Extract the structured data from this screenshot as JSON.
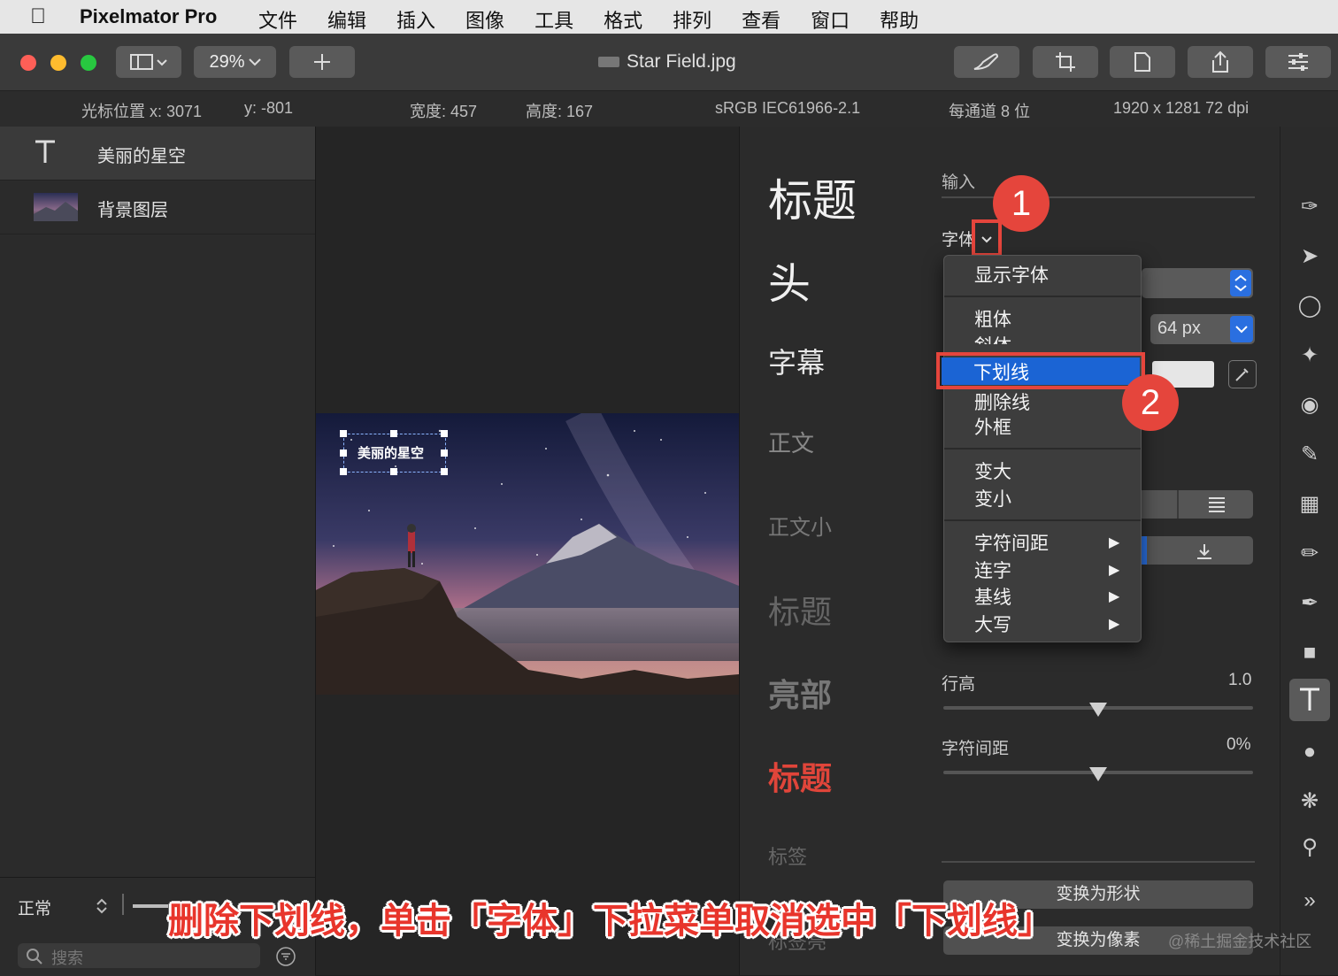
{
  "menubar": {
    "app_name": "Pixelmator Pro",
    "items": [
      "文件",
      "编辑",
      "插入",
      "图像",
      "工具",
      "格式",
      "排列",
      "查看",
      "窗口",
      "帮助"
    ]
  },
  "toolbar": {
    "zoom": "29%",
    "document_title": "Star Field.jpg"
  },
  "infobar": {
    "cursor_x": "光标位置 x:  3071",
    "cursor_y": "y:  -801",
    "width": "宽度:  457",
    "height": "高度:  167",
    "color_profile": "sRGB IEC61966-2.1",
    "bit_depth": "每通道 8 位",
    "dimensions": "1920 x 1281 72 dpi"
  },
  "layers": {
    "items": [
      {
        "label": "美丽的星空",
        "type": "text"
      },
      {
        "label": "背景图层",
        "type": "image"
      }
    ],
    "blend_mode": "正常",
    "search_placeholder": "搜索"
  },
  "canvas": {
    "overlay_text": "美丽的星空"
  },
  "styles": {
    "items": [
      "标题",
      "头",
      "字幕",
      "正文",
      "正文小",
      "标题",
      "亮部",
      "标题",
      "标签",
      "标签亮"
    ]
  },
  "inspector": {
    "input_label": "输入",
    "font_label": "字体",
    "size_value": "64 px",
    "line_height_label": "行高",
    "line_height_value": "1.0",
    "char_spacing_label": "字符间距",
    "char_spacing_value": "0%",
    "convert_shape": "变换为形状",
    "convert_pixels": "变换为像素"
  },
  "font_menu": {
    "show_fonts": "显示字体",
    "bold": "粗体",
    "italic": "斜体",
    "underline": "下划线",
    "strikethrough": "删除线",
    "outline": "外框",
    "bigger": "变大",
    "smaller": "变小",
    "kerning": "字符间距",
    "ligature": "连字",
    "baseline": "基线",
    "capitalization": "大写"
  },
  "callouts": {
    "one": "1",
    "two": "2"
  },
  "caption": "删除下划线，单击「字体」下拉菜单取消选中「下划线」",
  "watermark": "@稀土掘金技术社区",
  "colors": {
    "accent": "#e5453c",
    "selection": "#1b64d4",
    "style_red": "#e0453a"
  }
}
